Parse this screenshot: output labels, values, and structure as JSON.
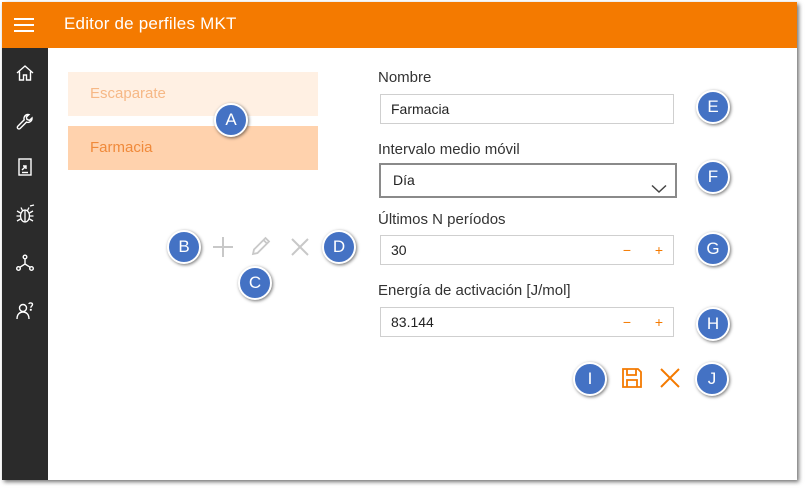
{
  "app": {
    "title": "Editor de perfiles MKT"
  },
  "colors": {
    "accent": "#f47a00",
    "sidebar": "#2b2b2b",
    "marker": "#4472c4"
  },
  "sidebar": {
    "items": [
      {
        "icon": "home-icon"
      },
      {
        "icon": "wrench-icon"
      },
      {
        "icon": "report-icon"
      },
      {
        "icon": "bug-icon"
      },
      {
        "icon": "network-icon"
      },
      {
        "icon": "user-help-icon"
      }
    ]
  },
  "profiles": {
    "items": [
      {
        "label": "Escaparate",
        "selected": false
      },
      {
        "label": "Farmacia",
        "selected": true
      }
    ]
  },
  "list_toolbar": {
    "add_icon": "plus-icon",
    "edit_icon": "pencil-icon",
    "delete_icon": "close-icon"
  },
  "form": {
    "nombre": {
      "label": "Nombre",
      "value": "Farmacia"
    },
    "intervalo": {
      "label": "Intervalo medio móvil",
      "value": "Día"
    },
    "periodos": {
      "label": "Últimos N períodos",
      "value": "30",
      "minus": "−",
      "plus": "+"
    },
    "energia": {
      "label": "Energía de activación [J/mol]",
      "value": "83.144",
      "minus": "−",
      "plus": "+"
    }
  },
  "actions": {
    "save_icon": "save-icon",
    "cancel_icon": "close-icon"
  },
  "markers": {
    "a": "A",
    "b": "B",
    "c": "C",
    "d": "D",
    "e": "E",
    "f": "F",
    "g": "G",
    "h": "H",
    "i": "I",
    "j": "J"
  }
}
